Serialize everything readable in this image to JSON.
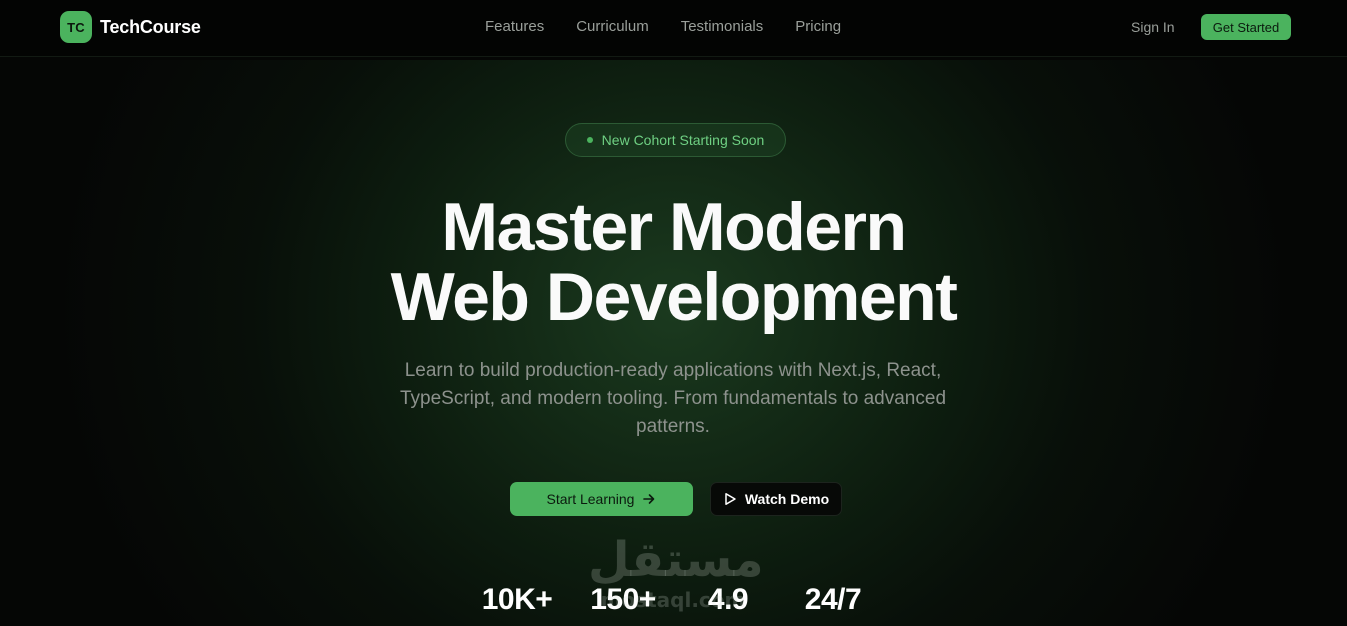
{
  "brand": {
    "logo_text": "TC",
    "name": "TechCourse",
    "accent_color": "#4bb35e"
  },
  "nav": {
    "links": [
      "Features",
      "Curriculum",
      "Testimonials",
      "Pricing"
    ],
    "sign_in": "Sign In",
    "cta": "Get Started"
  },
  "hero": {
    "badge": "New Cohort Starting Soon",
    "headline_line1": "Master Modern",
    "headline_line2": "Web Development",
    "subtitle": "Learn to build production-ready applications with Next.js, React, TypeScript, and modern tooling. From fundamentals to advanced patterns.",
    "primary_button": "Start Learning",
    "primary_button_icon": "arrow-right-icon",
    "secondary_button": "Watch Demo",
    "secondary_button_icon": "play-icon"
  },
  "stats": [
    "10K+",
    "150+",
    "4.9",
    "24/7"
  ],
  "watermark": {
    "arabic": "مستقل",
    "latin": "mostaql.com"
  }
}
